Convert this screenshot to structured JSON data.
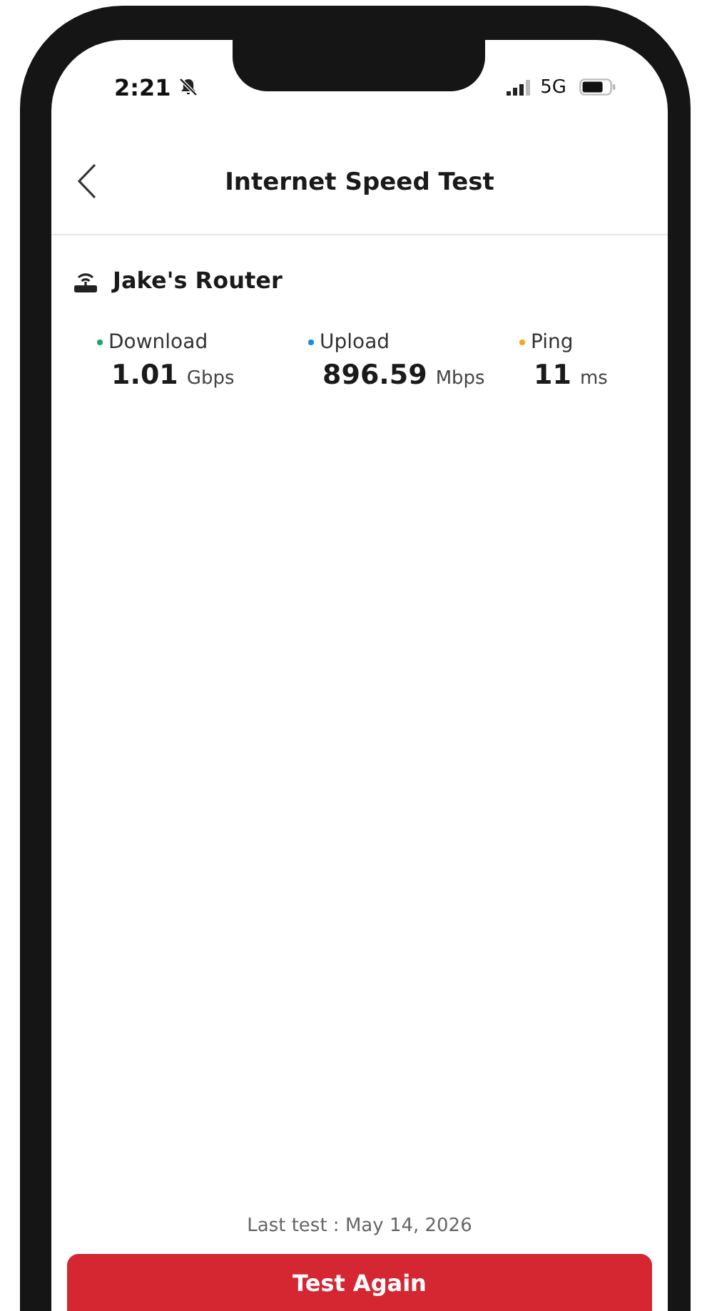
{
  "status_bar": {
    "time": "2:21",
    "network": "5G"
  },
  "header": {
    "title": "Internet Speed Test"
  },
  "router": {
    "name": "Jake's Router"
  },
  "metrics": [
    {
      "label": "Download",
      "value": "1.01",
      "unit": "Gbps",
      "color": "#1aa36b"
    },
    {
      "label": "Upload",
      "value": "896.59",
      "unit": "Mbps",
      "color": "#1e88e5"
    },
    {
      "label": "Ping",
      "value": "11",
      "unit": "ms",
      "color": "#f5a623"
    }
  ],
  "last_test": "Last test : May 14, 2026",
  "button": "Test Again"
}
